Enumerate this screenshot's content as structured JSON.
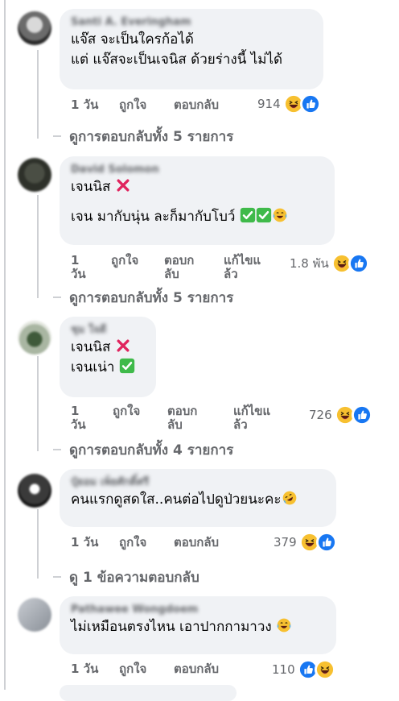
{
  "comments": [
    {
      "author": "Santi A. Everingham",
      "lines": [
        "แจ๊ส จะเป็นใครก้อได้",
        "แต่ แจ๊สจะเป็นเจนิส ด้วยร่างนี้ ไม่ได้"
      ],
      "time": "1 วัน",
      "like": "ถูกใจ",
      "reply": "ตอบกลับ",
      "edited": "",
      "reactions": "914",
      "reaction_icons": [
        "laugh-icon",
        "like-icon"
      ],
      "view_replies": "ดูการตอบกลับทั้ง 5 รายการ"
    },
    {
      "author": "David Solomon",
      "line1_text": "เจนนิส",
      "line1_emoji": "cross-mark-icon",
      "line2_text": "เจน มากับนุ่น ละก็มากับโบว์",
      "line2_emojis": [
        "check-mark-icon",
        "check-mark-icon",
        "laugh-tears-icon"
      ],
      "time": "1 วัน",
      "like": "ถูกใจ",
      "reply": "ตอบกลับ",
      "edited": "แก้ไขแล้ว",
      "reactions": "1.8 พัน",
      "reaction_icons": [
        "laugh-icon",
        "like-icon"
      ],
      "view_replies": "ดูการตอบกลับทั้ง 5 รายการ"
    },
    {
      "author": "ชุม ใจดี",
      "line1_text": "เจนนิส",
      "line1_emoji": "cross-mark-icon",
      "line2_text": "เจนเน่า",
      "line2_emoji": "check-mark-icon",
      "time": "1 วัน",
      "like": "ถูกใจ",
      "reply": "ตอบกลับ",
      "edited": "แก้ไขแล้ว",
      "reactions": "726",
      "reaction_icons": [
        "laugh-icon",
        "like-icon"
      ],
      "view_replies": "ดูการตอบกลับทั้ง 4 รายการ"
    },
    {
      "author": "ปุ๋ยอม เพ็ยศักดิ์ศรี",
      "line1_text": "คนแรกดูสดใส..คนต่อไปดูป่วยนะคะ",
      "line1_emoji": "rofl-icon",
      "time": "1 วัน",
      "like": "ถูกใจ",
      "reply": "ตอบกลับ",
      "edited": "",
      "reactions": "379",
      "reaction_icons": [
        "laugh-icon",
        "like-icon"
      ],
      "view_replies": "ดู 1 ข้อความตอบกลับ"
    },
    {
      "author": "Pathawee Wongdoem",
      "line1_text": "ไม่เหมือนตรงไหน เอาปากกามาวง",
      "line1_emoji": "laugh-tears-icon",
      "time": "1 วัน",
      "like": "ถูกใจ",
      "reply": "ตอบกลับ",
      "edited": "",
      "reactions": "110",
      "reaction_icons": [
        "like-icon",
        "laugh-icon"
      ]
    }
  ],
  "colors": {
    "bubble": "#f0f2f5",
    "secondary_text": "#65676b",
    "like_blue": "#1877f2",
    "laugh_yellow": "#f7c030",
    "check_green": "#3fba4a",
    "cross_red": "#e0245e"
  }
}
